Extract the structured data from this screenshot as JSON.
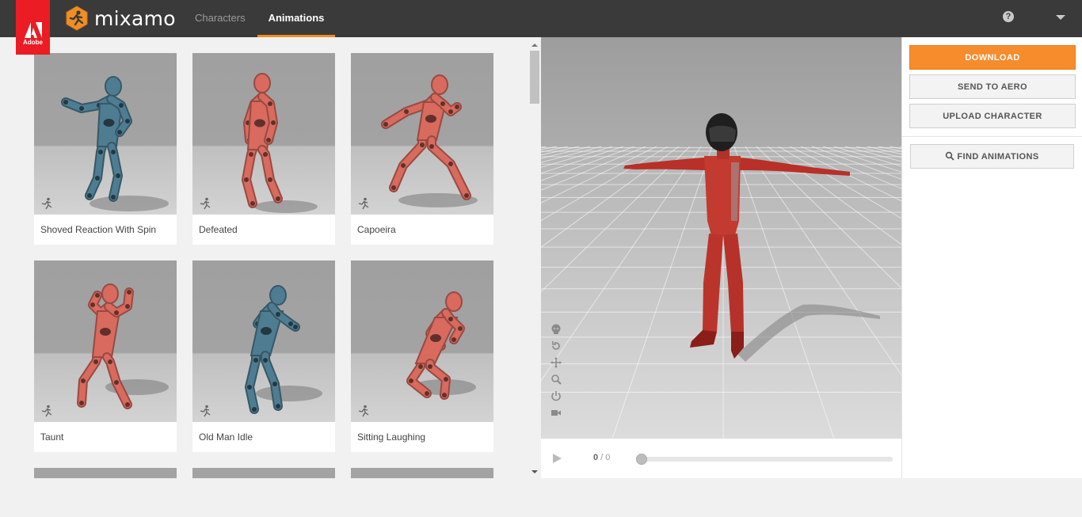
{
  "topbar": {
    "adobe_label": "Adobe",
    "app_name": "mixamo",
    "tabs": [
      {
        "label": "Characters",
        "active": false
      },
      {
        "label": "Animations",
        "active": true
      }
    ],
    "help_glyph": "?"
  },
  "animations": [
    {
      "name": "Shoved Reaction With Spin",
      "color": "#4e7d92",
      "pose": "spin"
    },
    {
      "name": "Defeated",
      "color": "#d96a5e",
      "pose": "defeated"
    },
    {
      "name": "Capoeira",
      "color": "#d96a5e",
      "pose": "capoeira"
    },
    {
      "name": "Taunt",
      "color": "#d96a5e",
      "pose": "taunt"
    },
    {
      "name": "Old Man Idle",
      "color": "#4e7d92",
      "pose": "oldman"
    },
    {
      "name": "Sitting Laughing",
      "color": "#d96a5e",
      "pose": "sitting"
    }
  ],
  "viewer": {
    "frame_current": "0",
    "frame_separator": " / ",
    "frame_total": "0",
    "progress": 0
  },
  "actions": {
    "download": "DOWNLOAD",
    "send_to_aero": "SEND TO AERO",
    "upload_character": "UPLOAD CHARACTER",
    "find_animations": "FIND ANIMATIONS"
  },
  "colors": {
    "accent": "#f68c2c",
    "topbar": "#3a3a3a",
    "adobe_red": "#eb1c24",
    "suit_red": "#c0352c"
  }
}
